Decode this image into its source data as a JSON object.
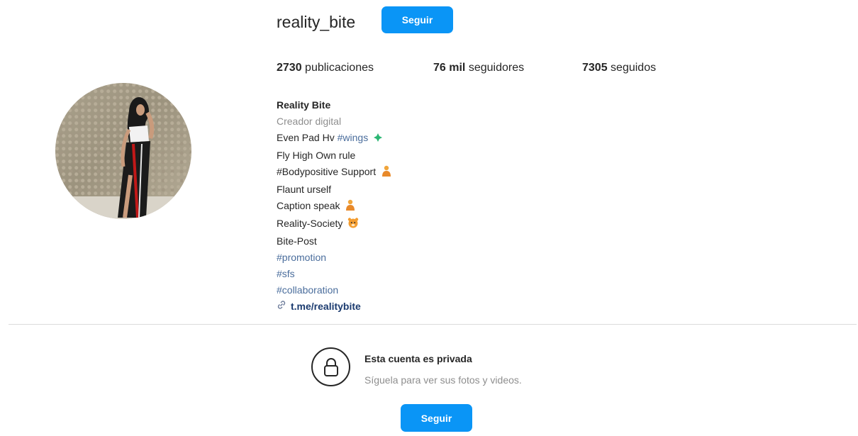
{
  "profile": {
    "username": "reality_bite",
    "follow_label": "Seguir",
    "stats": {
      "posts_count": "2730",
      "posts_label": "publicaciones",
      "followers_count": "76 mil",
      "followers_label": "seguidores",
      "following_count": "7305",
      "following_label": "seguidos"
    },
    "bio": {
      "name": "Reality Bite",
      "category": "Creador digital",
      "line1_text": "Even Pad Hv",
      "line1_tag": "#wings",
      "line2": "Fly High Own rule",
      "line3": "#Bodypositive Support",
      "line4": "Flaunt urself",
      "line5": "Caption speak",
      "line6": "Reality-Society",
      "line7": "Bite-Post",
      "tag1": "#promotion",
      "tag2": "#sfs",
      "tag3": "#collaboration",
      "link": "t.me/realitybite"
    }
  },
  "private_notice": {
    "title": "Esta cuenta es privada",
    "subtitle": "Síguela para ver sus fotos y videos.",
    "follow_label": "Seguir"
  },
  "icons": {
    "avatar": "profile-photo",
    "sparkle": "green-sparkle-emoji",
    "person": "person-emoji",
    "tiger": "tiger-emoji",
    "link": "link-icon",
    "lock": "lock-icon"
  },
  "colors": {
    "accent": "#0a95f6",
    "hashtag": "#4a6d9c",
    "muted": "#8e8e8e",
    "text": "#262626"
  }
}
